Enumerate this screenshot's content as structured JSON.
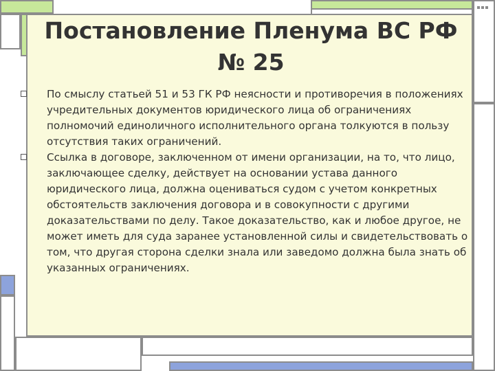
{
  "slide": {
    "title": "Постановление Пленума ВС РФ № 25",
    "bullets": [
      {
        "text": "По смыслу статьей 51 и 53 ГК РФ неясности и противоречия в положениях учредительных документов юридического лица об ограничениях полномочий единоличного исполнительного органа толкуются в пользу отсутствия таких ограничений."
      },
      {
        "text": "Ссылка в договоре, заключенном от имени организации, на то, что лицо, заключающее сделку, действует на основании устава данного юридического лица, должна оцениваться судом с учетом конкретных обстоятельств заключения договора и в совокупности с другими доказательствами по делу. Такое доказательство, как и любое другое, не может иметь для суда заранее установленной силы и свидетельствовать о том, что другая сторона сделки знала или заведомо должна была знать об указанных ограничениях."
      }
    ]
  },
  "colors": {
    "panel_background": "#fafadc",
    "accent_green": "#c7e89a",
    "accent_blue": "#8da3dc",
    "frame_border": "#8c8c8c",
    "text": "#333333"
  }
}
